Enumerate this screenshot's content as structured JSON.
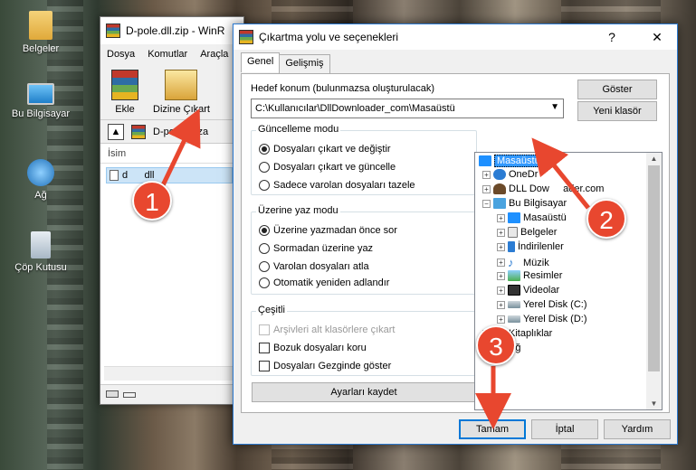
{
  "desktop": {
    "icons": [
      {
        "label": "Belgeler"
      },
      {
        "label": "Bu Bilgisayar"
      },
      {
        "label": "Ağ"
      },
      {
        "label": "Çöp Kutusu"
      }
    ]
  },
  "winrar": {
    "title": "D-pole.dll.zip - WinR",
    "menu": [
      "Dosya",
      "Komutlar",
      "Araçla"
    ],
    "toolbar": {
      "add_label": "Ekle",
      "extract_label": "Dizine Çıkart"
    },
    "path": "D-pole.dll.za",
    "column_name": "İsim",
    "file": "d      dll"
  },
  "dialog": {
    "title": "Çıkartma yolu ve seçenekleri",
    "help_btn": "?",
    "close_btn": "✕",
    "tabs": [
      "Genel",
      "Gelişmiş"
    ],
    "dest_label": "Hedef konum (bulunmazsa oluşturulacak)",
    "dest_value": "C:\\Kullanıcılar\\DllDownloader_com\\Masaüstü",
    "show_btn": "Göster",
    "new_folder_btn": "Yeni klasör",
    "update_mode": {
      "title": "Güncelleme modu",
      "options": [
        "Dosyaları çıkart ve değiştir",
        "Dosyaları çıkart ve güncelle",
        "Sadece varolan dosyaları tazele"
      ]
    },
    "overwrite_mode": {
      "title": "Üzerine yaz modu",
      "options": [
        "Üzerine yazmadan önce sor",
        "Sormadan üzerine yaz",
        "Varolan dosyaları atla",
        "Otomatik yeniden adlandır"
      ]
    },
    "misc": {
      "title": "Çeşitli",
      "options": [
        "Arşivleri alt klasörlere çıkart",
        "Bozuk dosyaları koru",
        "Dosyaları Gezginde göster"
      ]
    },
    "save_btn": "Ayarları kaydet",
    "tree": [
      "Masaüstü",
      "OneDr",
      "DLL Dow     ader.com",
      "Bu Bilgisayar",
      "Masaüstü",
      "Belgeler",
      "İndirilenler",
      "Müzik",
      "Resimler",
      "Videolar",
      "Yerel Disk (C:)",
      "Yerel Disk (D:)",
      "Kitaplıklar",
      "Ağ"
    ],
    "ok_btn": "Tamam",
    "cancel_btn": "İptal",
    "help2_btn": "Yardım"
  },
  "annotations": [
    "1",
    "2",
    "3"
  ],
  "colors": {
    "badge": "#e8472f",
    "selection": "#cce8ff",
    "accent": "#0078d7"
  }
}
